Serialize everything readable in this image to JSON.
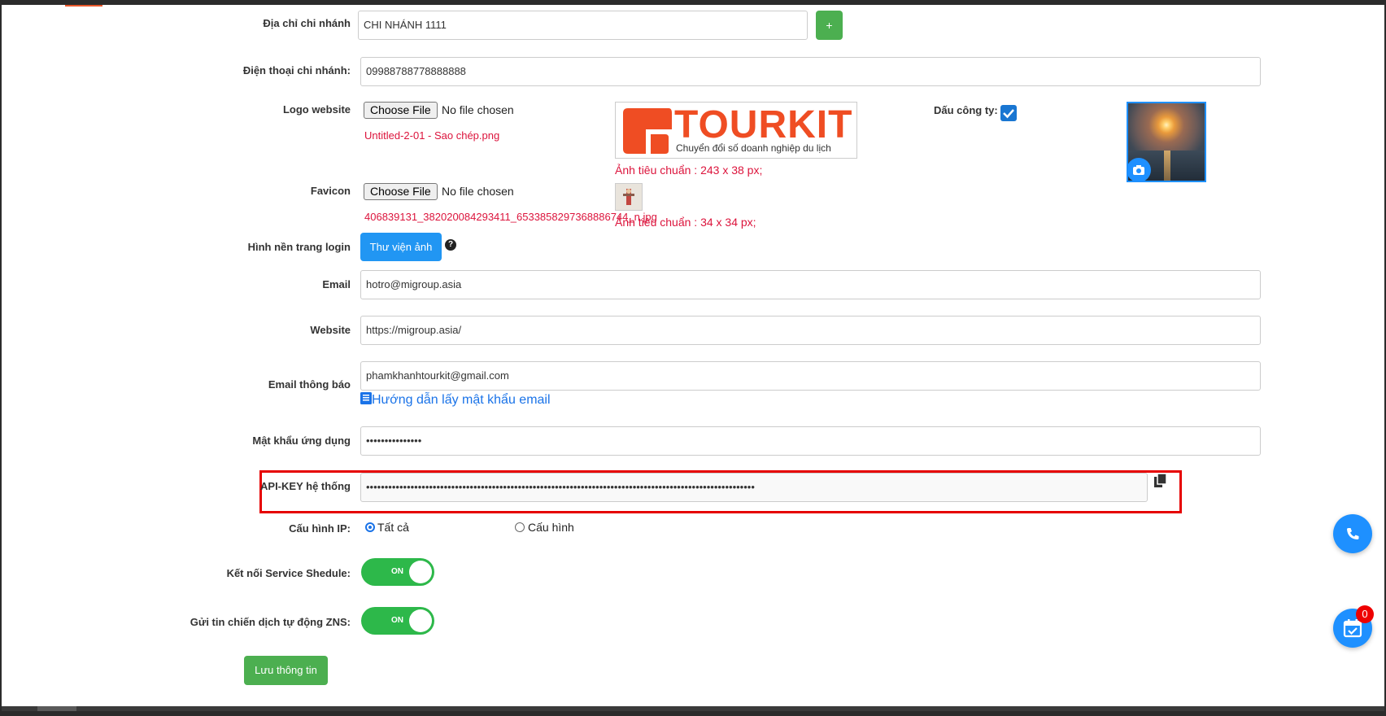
{
  "branch_address": {
    "label": "Địa chỉ chi nhánh",
    "value": "CHI NHÁNH 1111",
    "add_label": "+"
  },
  "branch_phone": {
    "label": "Điện thoại chi nhánh:",
    "value": "09988788778888888"
  },
  "logo": {
    "label": "Logo website",
    "choose_label": "Choose File",
    "status": "No file chosen",
    "filename": "Untitled-2-01 - Sao chép.png",
    "brand_text": "TOURKIT",
    "brand_tagline": "Chuyển đổi số doanh nghiệp du lịch",
    "size_hint": "Ảnh tiêu chuẩn : 243 x 38 px;"
  },
  "company_seal": {
    "label": "Dấu công ty:",
    "checked": true
  },
  "favicon": {
    "label": "Favicon",
    "choose_label": "Choose File",
    "status": "No file chosen",
    "filename": "406839131_382020084293411_6533858297368886744_n.jpg",
    "size_hint": "Ảnh tiêu chuẩn : 34 x 34 px;"
  },
  "login_bg": {
    "label": "Hình nền trang login",
    "button": "Thư viện ảnh"
  },
  "email": {
    "label": "Email",
    "value": "hotro@migroup.asia"
  },
  "website": {
    "label": "Website",
    "value": "https://migroup.asia/"
  },
  "notify_email": {
    "label": "Email thông báo",
    "value": "phamkhanhtourkit@gmail.com",
    "guide_link": "Hướng dẫn lấy mật khẩu email"
  },
  "app_password": {
    "label": "Mật khẩu ứng dụng",
    "value": "•••••••••••••••"
  },
  "api_key": {
    "label": "API-KEY hệ thống",
    "value": "•••••••••••••••••••••••••••••••••••••••••••••••••••••••••••••••••••••••••••••••••••••••••••••••••••••••••"
  },
  "ip_config": {
    "label": "Cấu hình IP:",
    "options": [
      "Tất cả",
      "Cấu hình"
    ],
    "selected": "Tất cả"
  },
  "service_schedule": {
    "label": "Kết nối Service Shedule:",
    "state": "ON"
  },
  "zns": {
    "label": "Gửi tin chiến dịch tự động ZNS:",
    "state": "ON"
  },
  "save_button": "Lưu thông tin",
  "task_badge": "0",
  "colors": {
    "accent_green": "#4caf50",
    "accent_blue": "#2196f3",
    "toggle_green": "#2db84a",
    "error_red": "#dc143c",
    "highlight_red": "#e60000"
  }
}
